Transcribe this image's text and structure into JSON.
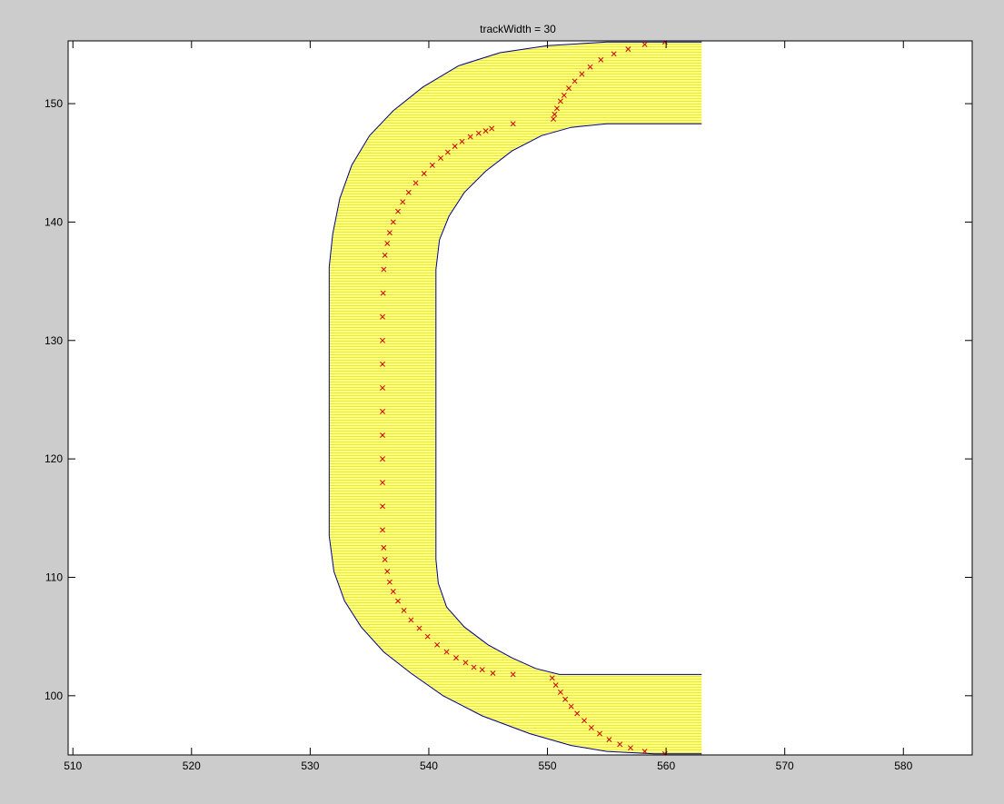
{
  "figure": {
    "background_color": "#cccccc",
    "axes_background_color": "#ffffff"
  },
  "chart_data": {
    "type": "line",
    "title": "trackWidth = 30",
    "xlabel": "",
    "ylabel": "",
    "xlim": [
      509.6,
      585.8
    ],
    "ylim": [
      95.0,
      155.3
    ],
    "grid": false,
    "x_ticks": [
      510,
      520,
      530,
      540,
      550,
      560,
      570,
      580
    ],
    "y_ticks": [
      100,
      110,
      120,
      130,
      140,
      150
    ],
    "x_tick_labels": [
      "510",
      "520",
      "530",
      "540",
      "550",
      "560",
      "570",
      "580"
    ],
    "y_tick_labels": [
      "100",
      "110",
      "120",
      "130",
      "140",
      "150"
    ],
    "track": {
      "fill_color": "#ffff80",
      "hatch_color": "#e8e840",
      "edge_color": "#00008b",
      "outer_boundary": [
        [
          563.0,
          155.2
        ],
        [
          560.0,
          155.2
        ],
        [
          555.0,
          155.2
        ],
        [
          550.0,
          154.9
        ],
        [
          546.0,
          154.3
        ],
        [
          542.5,
          153.2
        ],
        [
          539.5,
          151.4
        ],
        [
          537.0,
          149.4
        ],
        [
          535.0,
          147.3
        ],
        [
          533.5,
          144.8
        ],
        [
          532.5,
          142.0
        ],
        [
          531.9,
          139.0
        ],
        [
          531.6,
          136.2
        ],
        [
          531.6,
          130.0
        ],
        [
          531.6,
          120.0
        ],
        [
          531.6,
          113.5
        ],
        [
          532.0,
          110.5
        ],
        [
          532.9,
          108.0
        ],
        [
          534.3,
          105.8
        ],
        [
          536.2,
          103.7
        ],
        [
          538.5,
          101.9
        ],
        [
          541.2,
          100.0
        ],
        [
          544.5,
          98.3
        ],
        [
          548.5,
          96.8
        ],
        [
          552.0,
          95.8
        ],
        [
          555.0,
          95.3
        ],
        [
          559.0,
          95.1
        ],
        [
          563.0,
          95.1
        ]
      ],
      "inner_boundary": [
        [
          563.0,
          101.8
        ],
        [
          560.0,
          101.8
        ],
        [
          555.0,
          101.8
        ],
        [
          553.5,
          101.8
        ],
        [
          551.0,
          101.8
        ],
        [
          549.0,
          102.3
        ],
        [
          547.0,
          103.2
        ],
        [
          545.0,
          104.3
        ],
        [
          543.0,
          105.8
        ],
        [
          541.5,
          107.5
        ],
        [
          540.8,
          109.5
        ],
        [
          540.6,
          111.5
        ],
        [
          540.6,
          115.0
        ],
        [
          540.6,
          120.0
        ],
        [
          540.6,
          130.0
        ],
        [
          540.6,
          136.0
        ],
        [
          540.9,
          138.5
        ],
        [
          541.7,
          140.5
        ],
        [
          543.0,
          142.5
        ],
        [
          544.8,
          144.3
        ],
        [
          547.0,
          146.0
        ],
        [
          549.5,
          147.3
        ],
        [
          552.0,
          148.0
        ],
        [
          555.0,
          148.3
        ],
        [
          560.0,
          148.3
        ],
        [
          563.0,
          148.3
        ]
      ]
    },
    "series": [
      {
        "marker": "x",
        "color": "#cc0000",
        "points": [
          [
            559.9,
            155.2
          ],
          [
            558.2,
            155.0
          ],
          [
            556.8,
            154.6
          ],
          [
            555.6,
            154.2
          ],
          [
            554.5,
            153.7
          ],
          [
            553.6,
            153.1
          ],
          [
            552.9,
            152.5
          ],
          [
            552.3,
            151.9
          ],
          [
            551.8,
            151.3
          ],
          [
            551.4,
            150.7
          ],
          [
            551.1,
            150.2
          ],
          [
            550.8,
            149.6
          ],
          [
            550.6,
            149.1
          ],
          [
            550.5,
            148.7
          ],
          [
            547.1,
            148.3
          ],
          [
            545.3,
            147.9
          ],
          [
            544.8,
            147.7
          ],
          [
            544.2,
            147.5
          ],
          [
            543.5,
            147.2
          ],
          [
            542.8,
            146.8
          ],
          [
            542.2,
            146.4
          ],
          [
            541.6,
            145.9
          ],
          [
            541.0,
            145.4
          ],
          [
            540.3,
            144.8
          ],
          [
            539.6,
            144.1
          ],
          [
            538.9,
            143.3
          ],
          [
            538.3,
            142.5
          ],
          [
            537.8,
            141.7
          ],
          [
            537.4,
            140.9
          ],
          [
            537.0,
            140.0
          ],
          [
            536.7,
            139.1
          ],
          [
            536.5,
            138.2
          ],
          [
            536.3,
            137.2
          ],
          [
            536.2,
            136.0
          ],
          [
            536.15,
            134.0
          ],
          [
            536.1,
            132.0
          ],
          [
            536.1,
            130.0
          ],
          [
            536.1,
            128.0
          ],
          [
            536.1,
            126.0
          ],
          [
            536.1,
            124.0
          ],
          [
            536.1,
            122.0
          ],
          [
            536.1,
            120.0
          ],
          [
            536.1,
            118.0
          ],
          [
            536.1,
            116.0
          ],
          [
            536.1,
            114.0
          ],
          [
            536.2,
            112.5
          ],
          [
            536.3,
            111.5
          ],
          [
            536.5,
            110.5
          ],
          [
            536.7,
            109.6
          ],
          [
            537.0,
            108.8
          ],
          [
            537.4,
            108.0
          ],
          [
            537.9,
            107.2
          ],
          [
            538.5,
            106.4
          ],
          [
            539.2,
            105.7
          ],
          [
            539.9,
            105.0
          ],
          [
            540.7,
            104.3
          ],
          [
            541.5,
            103.7
          ],
          [
            542.3,
            103.2
          ],
          [
            543.1,
            102.8
          ],
          [
            543.8,
            102.4
          ],
          [
            544.5,
            102.2
          ],
          [
            545.4,
            101.9
          ],
          [
            547.1,
            101.8
          ],
          [
            550.4,
            101.5
          ],
          [
            550.7,
            100.9
          ],
          [
            551.1,
            100.3
          ],
          [
            551.5,
            99.7
          ],
          [
            552.0,
            99.1
          ],
          [
            552.5,
            98.5
          ],
          [
            553.1,
            97.9
          ],
          [
            553.7,
            97.3
          ],
          [
            554.4,
            96.8
          ],
          [
            555.2,
            96.3
          ],
          [
            556.1,
            95.9
          ],
          [
            557.0,
            95.6
          ],
          [
            558.2,
            95.3
          ],
          [
            559.9,
            95.1
          ]
        ]
      }
    ]
  }
}
